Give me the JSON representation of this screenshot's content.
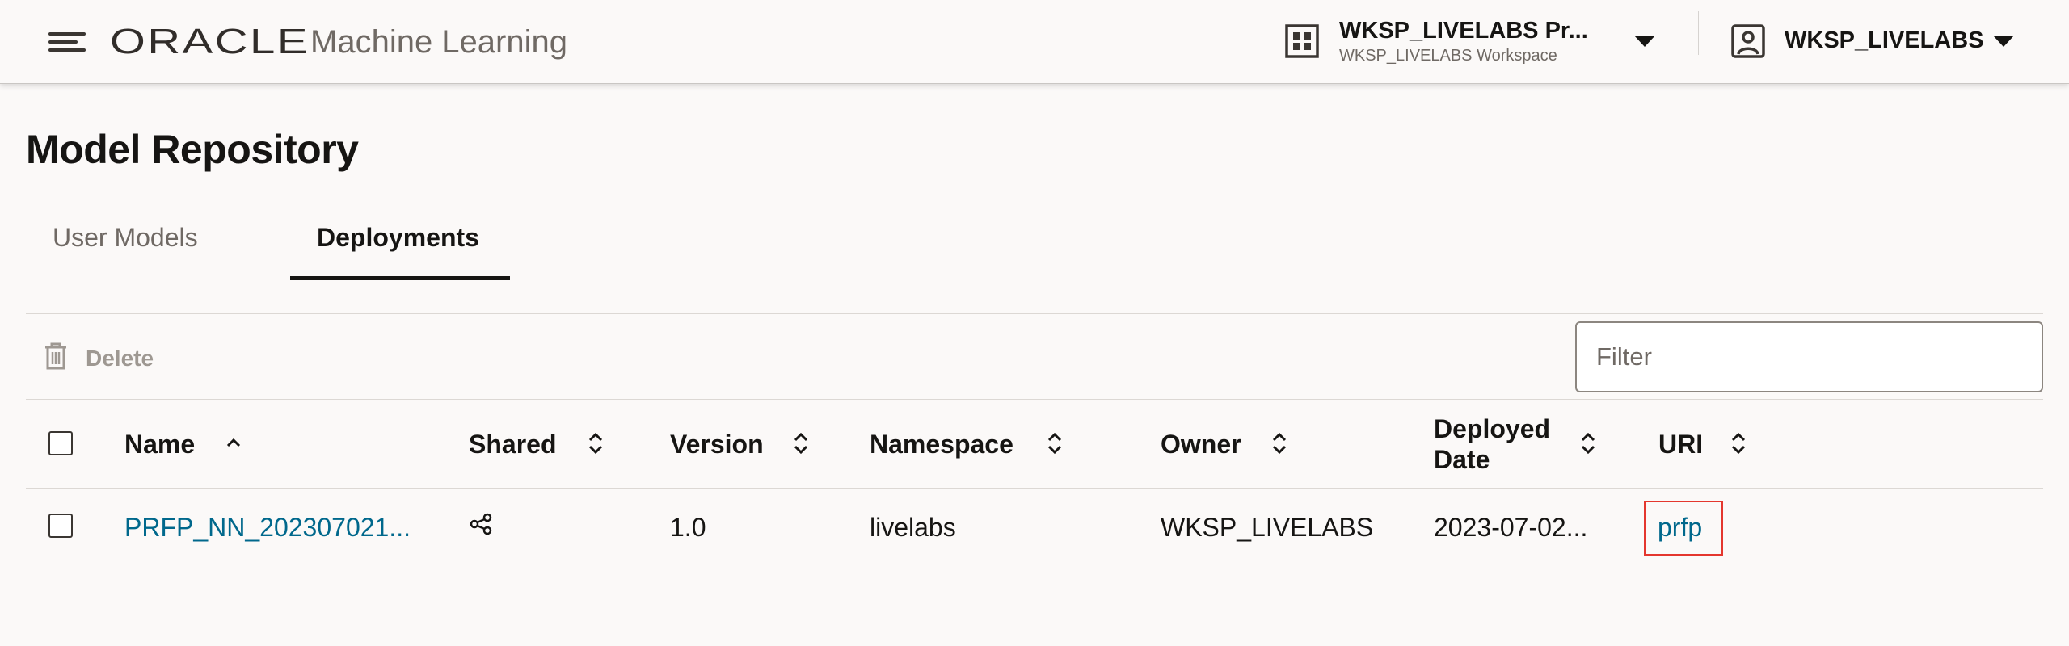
{
  "header": {
    "brand_logo": "ORACLE",
    "brand_product": "Machine Learning",
    "workspace_name": "WKSP_LIVELABS Pr...",
    "workspace_subtitle": "WKSP_LIVELABS Workspace",
    "user_name": "WKSP_LIVELABS",
    "icons": [
      "hamburger-menu-icon",
      "workspace-grid-icon",
      "chevron-down-icon",
      "user-badge-icon"
    ]
  },
  "page": {
    "title": "Model Repository",
    "tabs": [
      {
        "label": "User Models",
        "selected": false
      },
      {
        "label": "Deployments",
        "selected": true
      }
    ]
  },
  "toolbar": {
    "delete_label": "Delete",
    "delete_enabled": false,
    "filter_placeholder": "Filter"
  },
  "table": {
    "columns": [
      {
        "label": "Name",
        "sort": "ascending"
      },
      {
        "label": "Shared",
        "sort": "none"
      },
      {
        "label": "Version",
        "sort": "none"
      },
      {
        "label": "Namespace",
        "sort": "none"
      },
      {
        "label": "Owner",
        "sort": "none"
      },
      {
        "label_line1": "Deployed",
        "label_line2": "Date",
        "sort": "none"
      },
      {
        "label": "URI",
        "sort": "none"
      }
    ],
    "rows": [
      {
        "name": "PRFP_NN_202307021...",
        "shared_icon": "share-icon",
        "version": "1.0",
        "namespace": "livelabs",
        "owner": "WKSP_LIVELABS",
        "deployed_date": "2023-07-02...",
        "uri": "prfp",
        "uri_highlighted": true
      }
    ]
  },
  "colors": {
    "background": "#fbf9f8",
    "text": "#161513",
    "link": "#00688c",
    "highlight": "#e4372e",
    "muted": "#6f6964"
  }
}
